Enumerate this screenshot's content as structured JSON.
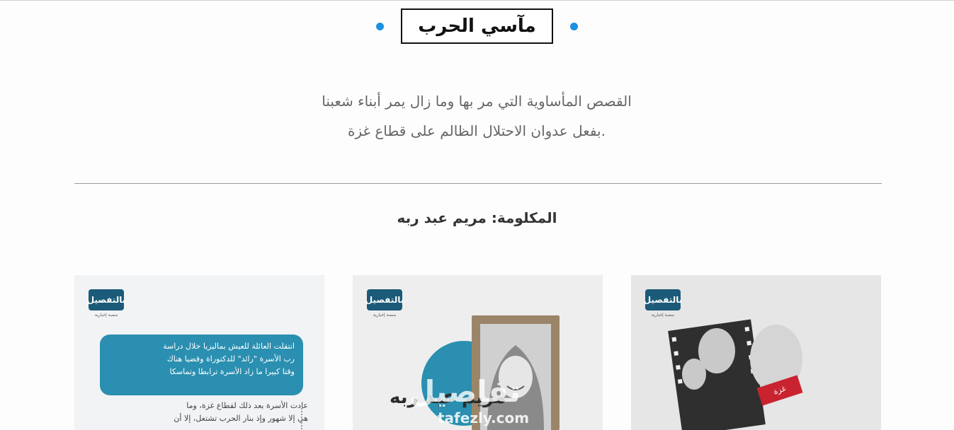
{
  "section": {
    "title": "مآسي الحرب",
    "intro_line1": "القصص المأساوية التي مر بها وما زال يمر أبناء شعبنا",
    "intro_line2": ".بفعل عدوان الاحتلال الظالم على قطاع غزة",
    "subject": "المكلومة: مريم عبد ربه"
  },
  "cards": {
    "logo_text": "بالتفصيل",
    "logo_tagline": "منصة إخبارية",
    "card1": {
      "bubble_lines": [
        "انتقلت العائلة للعيش بماليزيا خلال دراسة",
        "رب الأسرة \"رائد\" للدكتوراة وقضيا هناك",
        "وقتا كبيرا ما زاد الأسرة ترابطا وتماسكا"
      ],
      "body_lines": [
        "عادت الأسرة بعد ذلك لقطاع غزة، وما",
        "هي إلا شهور وإذ بنار الحرب تشتعل، إلا أن"
      ]
    },
    "card2": {
      "name_art": "مريم عبد ربه",
      "watermark": "تفاصيل",
      "watermark_url": "tafezly.com"
    },
    "card3": {
      "tag": "غزة"
    }
  },
  "colors": {
    "accent_dot": "#1e90e0",
    "brand_blue": "#1b5a78",
    "bubble": "#2a8fb0",
    "red": "#c9232f"
  }
}
